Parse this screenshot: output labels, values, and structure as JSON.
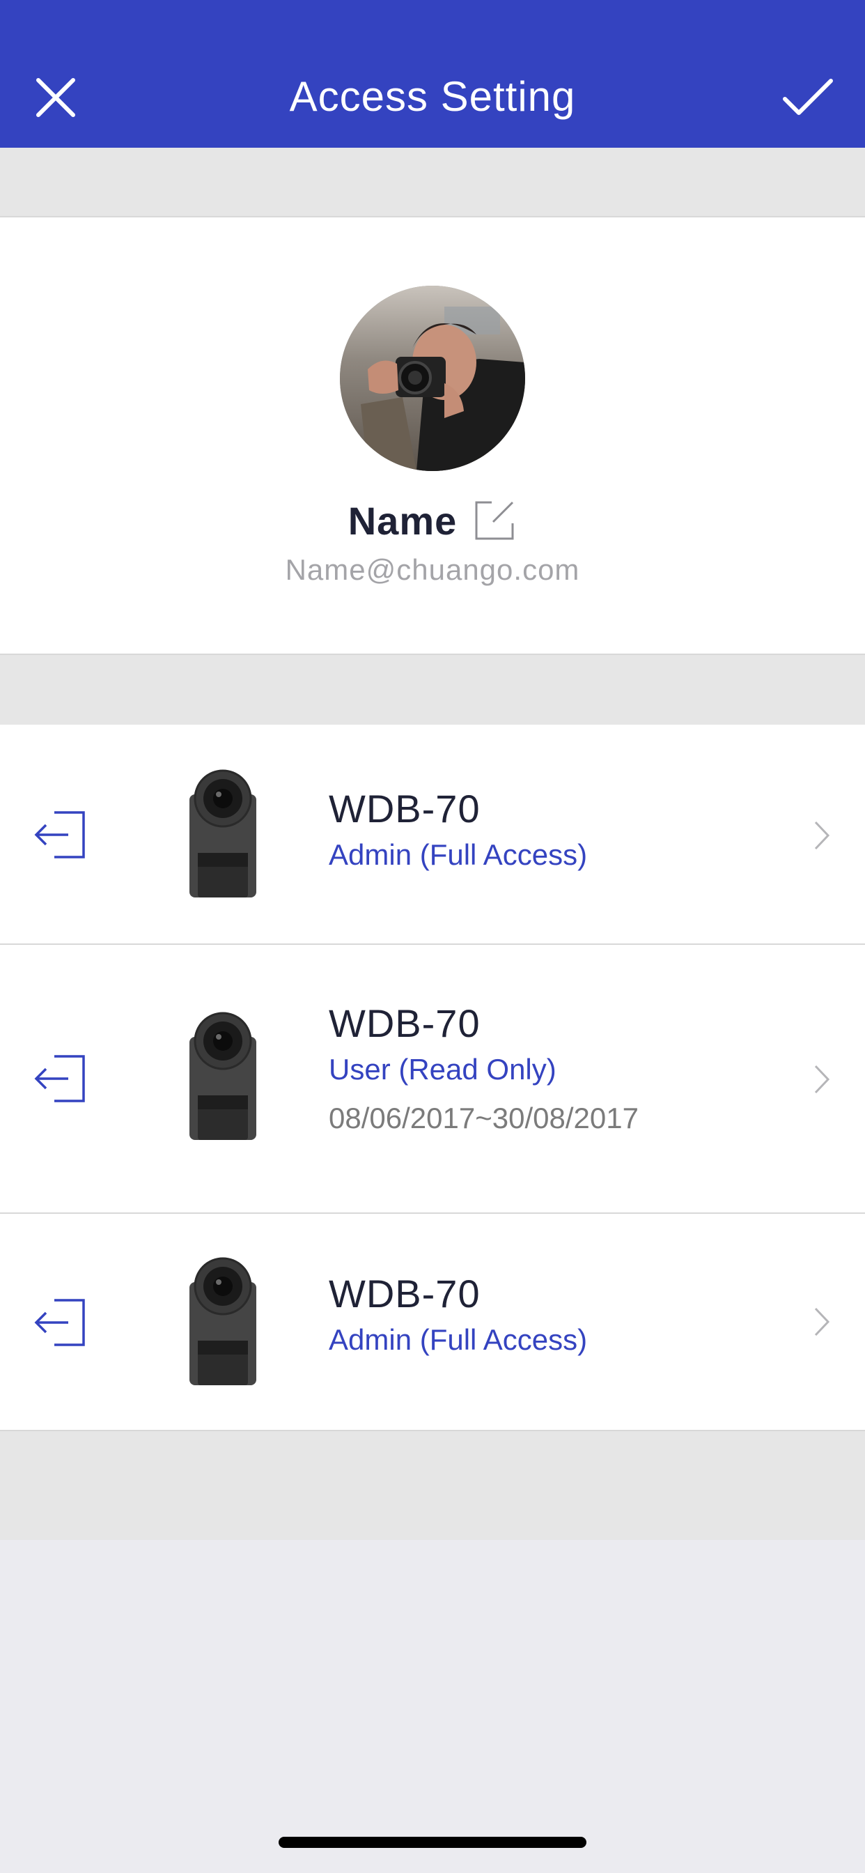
{
  "header": {
    "title": "Access Setting",
    "close_icon": "close-icon",
    "confirm_icon": "checkmark-icon",
    "background_color": "#3443c0"
  },
  "profile": {
    "avatar": "user-photo-avatar",
    "name": "Name",
    "edit_icon": "edit-icon",
    "email": "Name@chuango.com"
  },
  "devices": [
    {
      "name": "WDB-70",
      "role": "Admin (Full Access)",
      "date": "",
      "exit_icon": "exit-icon",
      "image": "doorbell-camera",
      "chevron_icon": "chevron-right-icon"
    },
    {
      "name": "WDB-70",
      "role": "User (Read Only)",
      "date": "08/06/2017~30/08/2017",
      "exit_icon": "exit-icon",
      "image": "doorbell-camera",
      "chevron_icon": "chevron-right-icon"
    },
    {
      "name": "WDB-70",
      "role": "Admin (Full Access)",
      "date": "",
      "exit_icon": "exit-icon",
      "image": "doorbell-camera",
      "chevron_icon": "chevron-right-icon"
    }
  ],
  "colors": {
    "accent": "#3443c0",
    "text_dark": "#1f2236",
    "text_gray": "#7b7b7b",
    "email_gray": "#a4a4a8"
  }
}
